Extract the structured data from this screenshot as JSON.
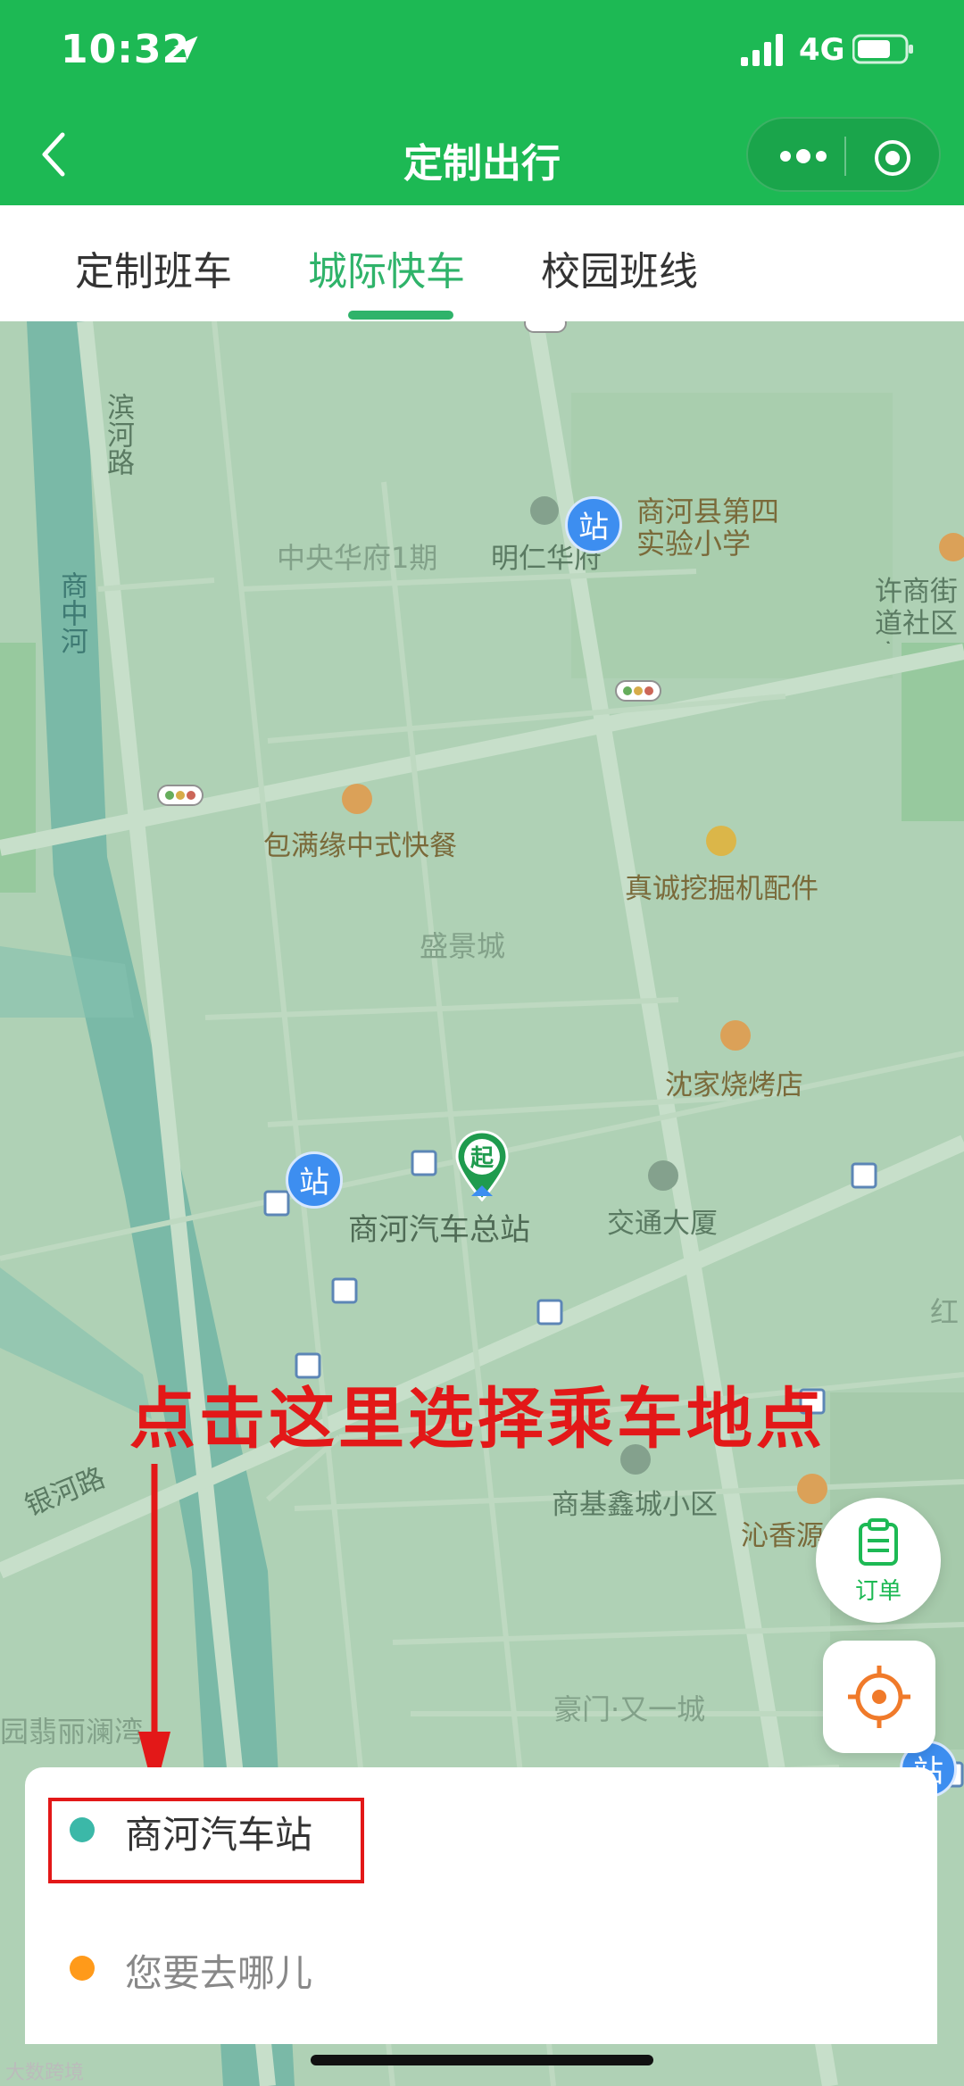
{
  "status": {
    "time": "10:32",
    "network": "4G"
  },
  "nav": {
    "title": "定制出行"
  },
  "tabs": [
    {
      "label": "定制班车"
    },
    {
      "label": "城际快车"
    },
    {
      "label": "校园班线"
    }
  ],
  "map": {
    "labels": {
      "binhe_road": "滨河路",
      "shangzhong_river": "商中河",
      "zhongyang_huafu": "中央华府1期",
      "mingren_huafu": "明仁华府",
      "school": "商河县第四实验小学",
      "xushang_community": "许商街道社区文",
      "baomanyuan": "包满缘中式快餐",
      "zhencheng": "真诚挖掘机配件",
      "shengjing": "盛景城",
      "shenjia_bbq": "沈家烧烤店",
      "bus_station": "商河汽车总站",
      "jiaotong_tower": "交通大厦",
      "yinhe_road": "银河路",
      "shangji_xincheng": "商基鑫城小区",
      "qinxiangyuan": "沁香源",
      "haomen": "豪门·又一城",
      "feicui_lanwan": "园翡丽澜湾",
      "hong": "红",
      "station_char": "站",
      "start_char": "起"
    }
  },
  "annotation": {
    "text": "点击这里选择乘车地点"
  },
  "fab": {
    "order_label": "订单"
  },
  "panel": {
    "origin": "商河汽车站",
    "destination_placeholder": "您要去哪儿",
    "origin_dot_color": "#3bb8a8",
    "destination_dot_color": "#ff9a1a"
  },
  "watermark": "大数跨境",
  "colors": {
    "brand": "#1db954",
    "accent_tab": "#2fb36a",
    "annotation_red": "#e31818"
  }
}
